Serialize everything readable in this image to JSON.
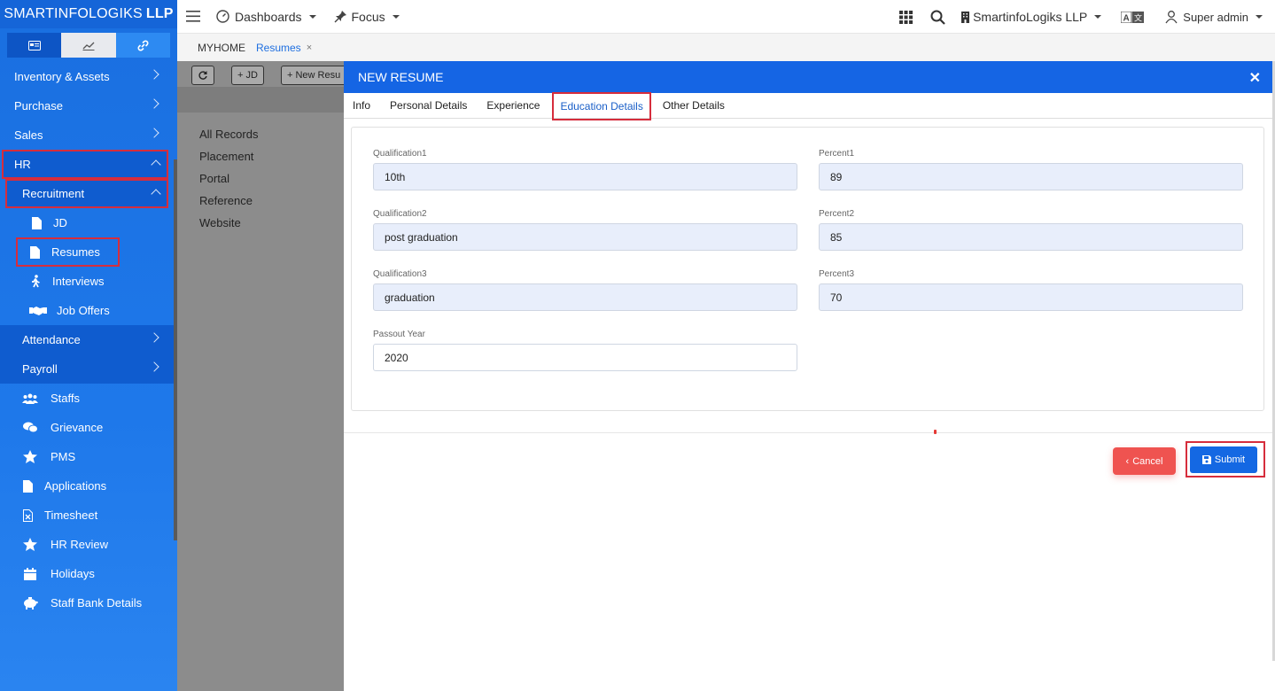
{
  "brand": {
    "name_light": "SMARTINFOLOGIKS",
    "name_bold": "LLP"
  },
  "topbar": {
    "dashboards": "Dashboards",
    "focus": "Focus",
    "company": "SmartinfoLogiks LLP",
    "user": "Super admin"
  },
  "breadcrumb": {
    "home": "MYHOME",
    "current": "Resumes",
    "close": "×"
  },
  "sidebar": {
    "items": [
      {
        "label": "Inventory & Assets"
      },
      {
        "label": "Purchase"
      },
      {
        "label": "Sales"
      },
      {
        "label": "HR"
      },
      {
        "label": "Recruitment"
      },
      {
        "label": "JD"
      },
      {
        "label": "Resumes"
      },
      {
        "label": "Interviews"
      },
      {
        "label": "Job Offers"
      },
      {
        "label": "Attendance"
      },
      {
        "label": "Payroll"
      },
      {
        "label": "Staffs"
      },
      {
        "label": "Grievance"
      },
      {
        "label": "PMS"
      },
      {
        "label": "Applications"
      },
      {
        "label": "Timesheet"
      },
      {
        "label": "HR Review"
      },
      {
        "label": "Holidays"
      },
      {
        "label": "Staff Bank Details"
      }
    ]
  },
  "background_page": {
    "buttons": [
      "+ JD",
      "+ New Resu"
    ],
    "list": [
      "All Records",
      "Placement",
      "Portal",
      "Reference",
      "Website"
    ]
  },
  "modal": {
    "title": "NEW RESUME",
    "tabs": [
      "Info",
      "Personal Details",
      "Experience",
      "Education Details",
      "Other Details"
    ],
    "active_tab": "Education Details",
    "fields": {
      "qualification1": {
        "label": "Qualification1",
        "value": "10th"
      },
      "percent1": {
        "label": "Percent1",
        "value": "89"
      },
      "qualification2": {
        "label": "Qualification2",
        "value": "post graduation"
      },
      "percent2": {
        "label": "Percent2",
        "value": "85"
      },
      "qualification3": {
        "label": "Qualification3",
        "value": "graduation"
      },
      "percent3": {
        "label": "Percent3",
        "value": "70"
      },
      "passout_year": {
        "label": "Passout Year",
        "value": "2020"
      }
    },
    "cancel_label": "Cancel",
    "submit_label": "Submit"
  },
  "colors": {
    "primary": "#1565e4",
    "cancel": "#ef5350",
    "highlight": "#d62d3c"
  }
}
